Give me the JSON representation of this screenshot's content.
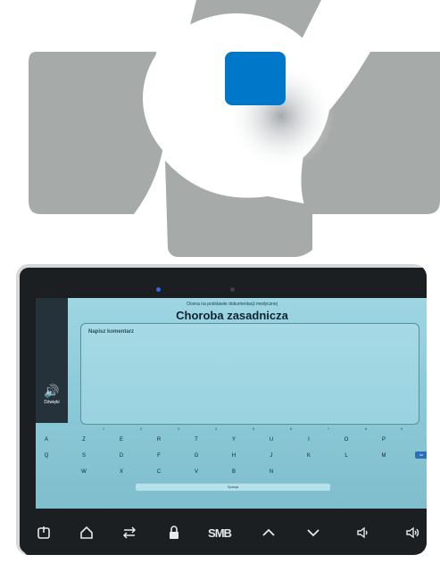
{
  "logo": {
    "brand_color": "#0077c8",
    "shape_color": "#a6aaa8"
  },
  "screen": {
    "subtitle": "Ocena na podstawie dokumentacji medycznej",
    "title": "Choroba zasadnicza",
    "comment_placeholder": "Napisz komentarz",
    "sound_label": "Dźwięki"
  },
  "keyboard": {
    "row_hints": [
      "1",
      "2",
      "3",
      "4",
      "5",
      "6",
      "7",
      "8",
      "9",
      "0"
    ],
    "row1": [
      "A",
      "Z",
      "E",
      "R",
      "T",
      "Y",
      "U",
      "I",
      "O",
      "P"
    ],
    "row2": [
      "Q",
      "S",
      "D",
      "F",
      "G",
      "H",
      "J",
      "K",
      "L",
      "M"
    ],
    "row3": [
      "W",
      "X",
      "C",
      "V",
      "B",
      "N"
    ],
    "enter_label": "OK",
    "space_label": "Spacja"
  },
  "navbar": {
    "brand": "SMB"
  }
}
